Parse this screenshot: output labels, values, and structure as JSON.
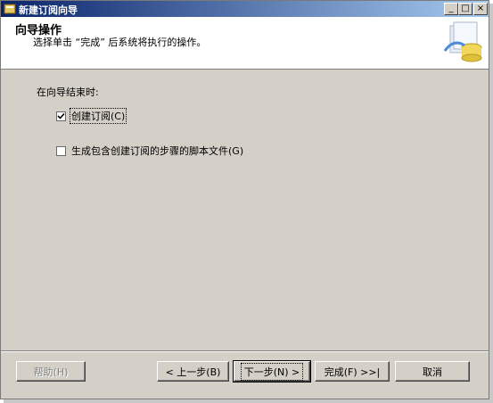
{
  "window": {
    "title": "新建订阅向导",
    "controls": {
      "minimize": "_",
      "maximize": "□",
      "close": "×"
    }
  },
  "header": {
    "title": "向导操作",
    "subtitle": "选择单击 “完成” 后系统将执行的操作。",
    "icon": "wizard-database-icon"
  },
  "body": {
    "section_label": "在向导结束时:",
    "options": [
      {
        "label": "创建订阅(C)",
        "checked": true
      },
      {
        "label": "生成包含创建订阅的步骤的脚本文件(G)",
        "checked": false
      }
    ]
  },
  "buttons": {
    "help": "帮助(H)",
    "back": "< 上一步(B)",
    "next": "下一步(N) >",
    "finish": "完成(F) >>|",
    "cancel": "取消"
  },
  "colors": {
    "dialog_bg": "#d4d0c8",
    "titlebar_start": "#0a246a",
    "titlebar_end": "#a6caf0"
  }
}
